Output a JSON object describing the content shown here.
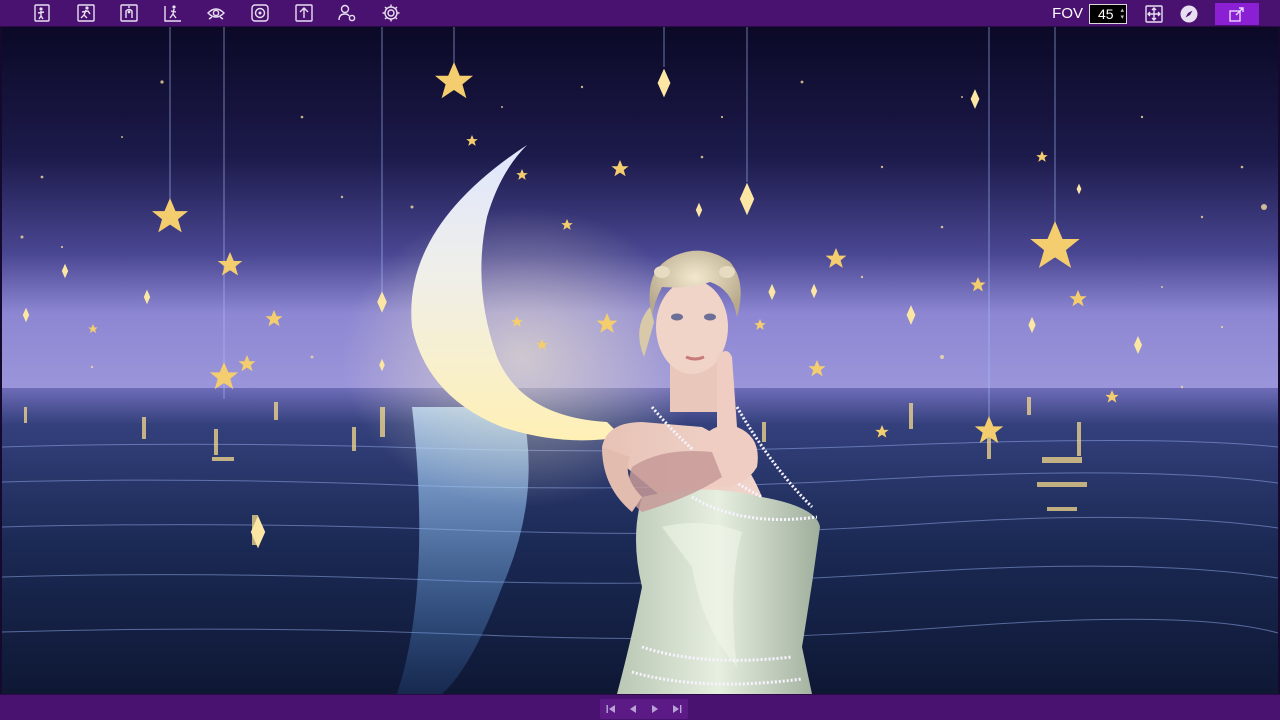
{
  "toolbar": {
    "tools": [
      {
        "icon": "pose-door-icon"
      },
      {
        "icon": "pose-run-icon"
      },
      {
        "icon": "pose-hand-icon"
      },
      {
        "icon": "pose-walk-icon"
      },
      {
        "icon": "eye-icon"
      },
      {
        "icon": "target-icon"
      },
      {
        "icon": "upload-icon"
      },
      {
        "icon": "user-settings-icon"
      },
      {
        "icon": "gear-icon"
      }
    ],
    "fov_label": "FOV",
    "fov_value": "45",
    "right_icons": [
      "move-icon",
      "compass-icon",
      "export-icon"
    ]
  },
  "playback": {
    "buttons": [
      "skip-start-icon",
      "step-back-icon",
      "play-icon",
      "skip-end-icon"
    ]
  },
  "colors": {
    "toolbar_bg": "#4a1270",
    "active_button": "#8a1fd4",
    "sky_top": "#0c0a2a",
    "horizon": "#8c83d4",
    "water": "#1a2a55",
    "moon": "#f3e7b4",
    "star": "#f2c766"
  }
}
